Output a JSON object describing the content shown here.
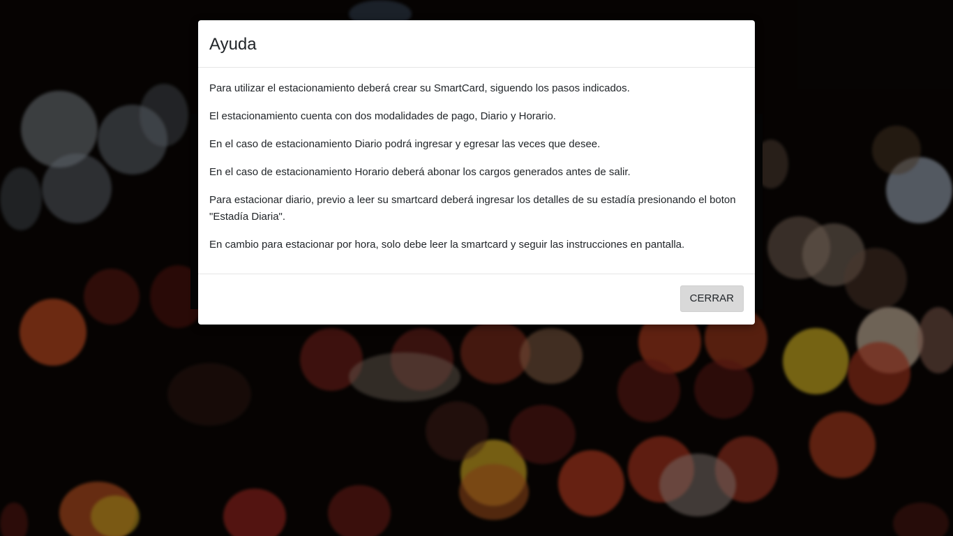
{
  "modal": {
    "title": "Ayuda",
    "paragraphs": [
      "Para utilizar el estacionamiento deberá crear su SmartCard, siguendo los pasos indicados.",
      "El estacionamiento cuenta con dos modalidades de pago, Diario y Horario.",
      "En el caso de estacionamiento Diario podrá ingresar y egresar las veces que desee.",
      "En el caso de estacionamiento Horario deberá abonar los cargos generados antes de salir.",
      "Para estacionar diario, previo a leer su smartcard deberá ingresar los detalles de su estadía presionando el boton \"Estadía Diaria\".",
      "En cambio para estacionar por hora, solo debe leer la smartcard y seguir las instrucciones en pantalla."
    ],
    "close_label": "CERRAR"
  },
  "colors": {
    "modal_background": "#ffffff",
    "text": "#212529",
    "button_background": "#d9d9d9"
  }
}
